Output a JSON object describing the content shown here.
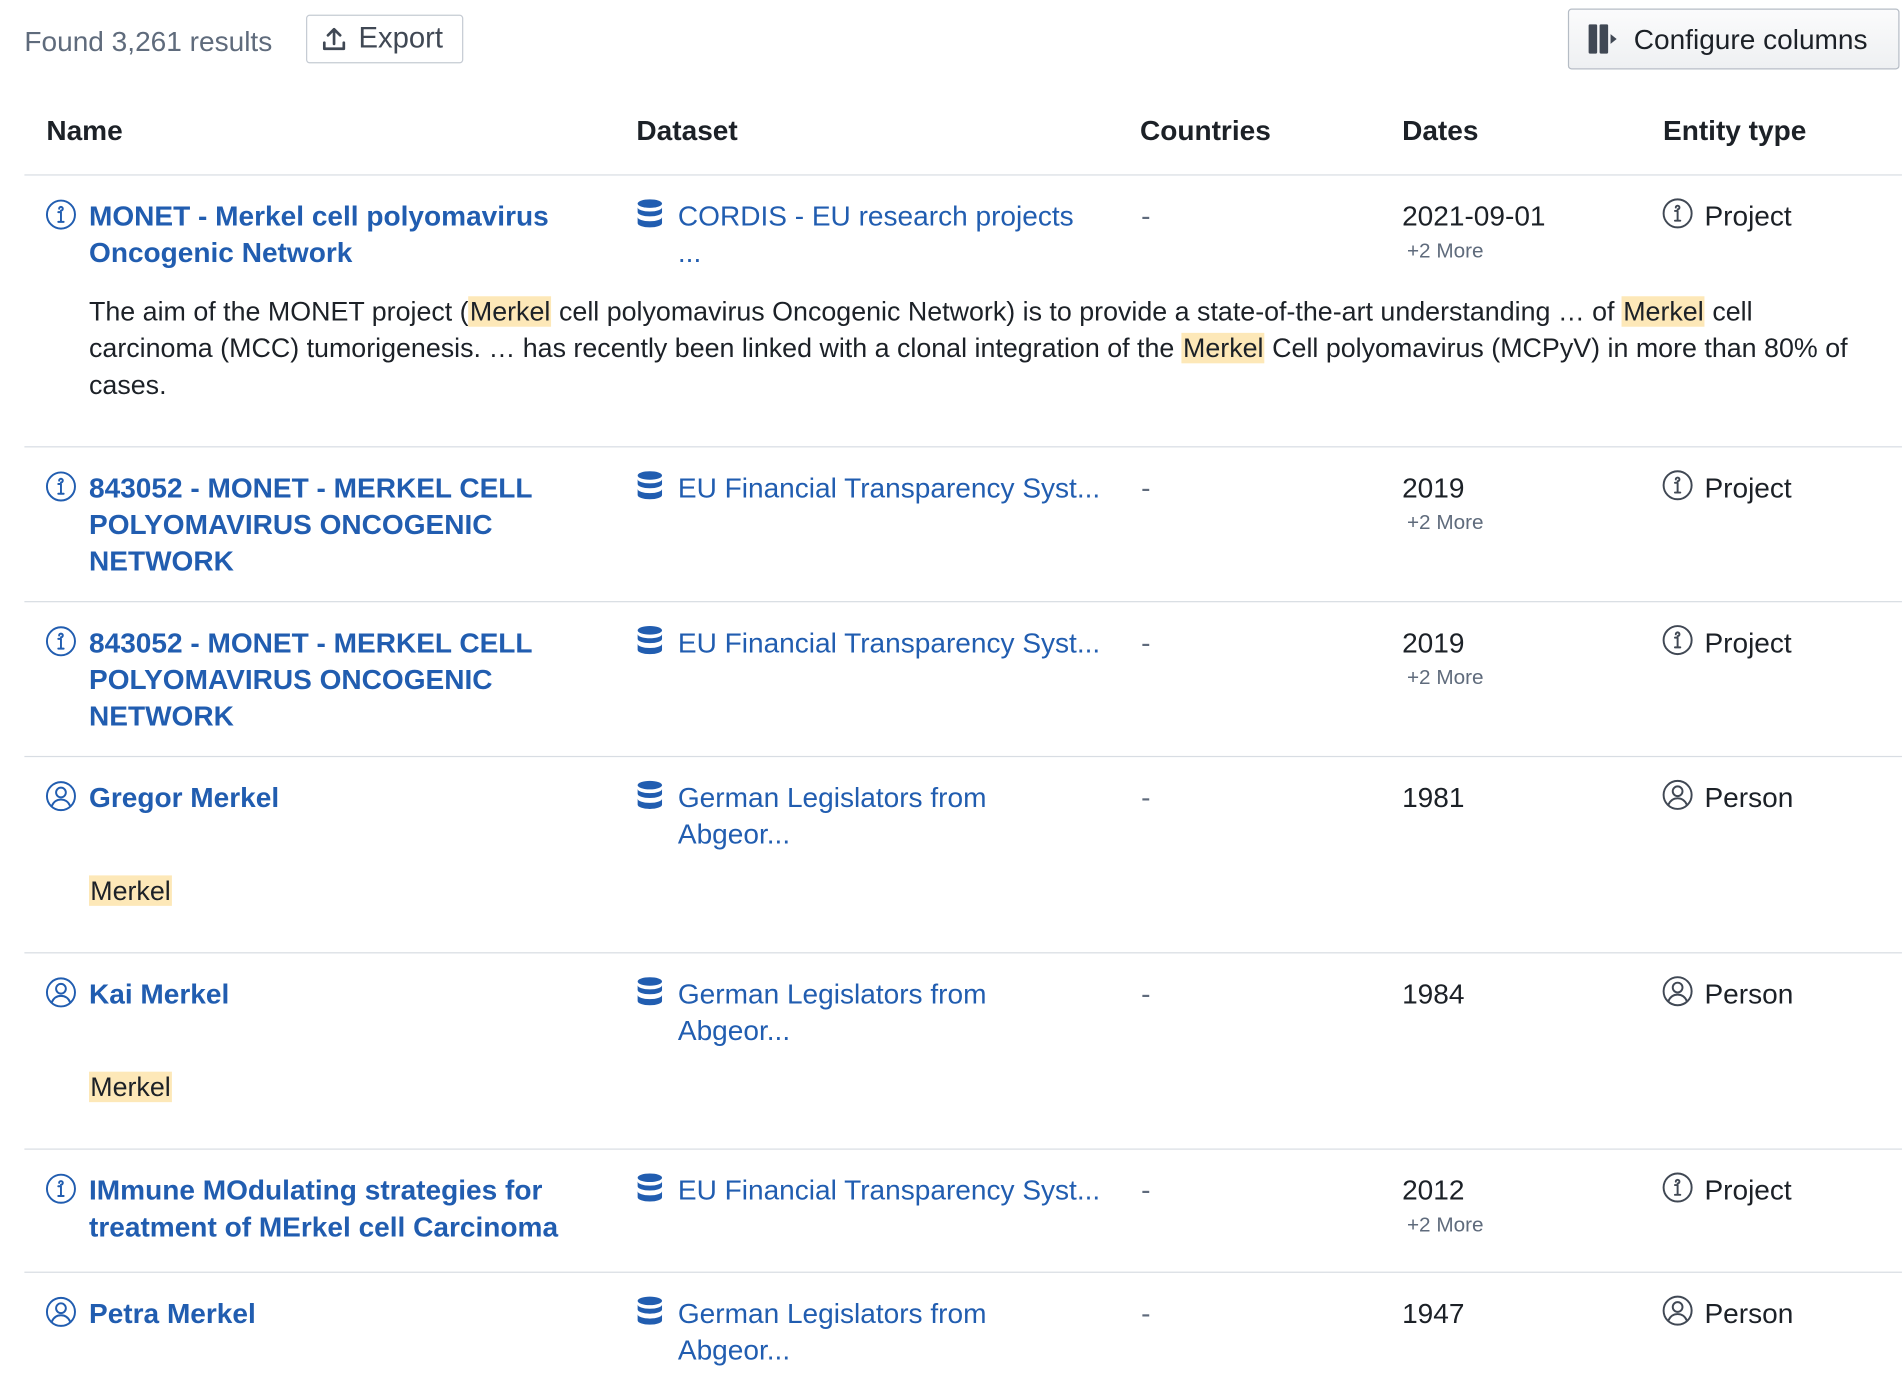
{
  "toolbar": {
    "found_text": "Found 3,261 results",
    "export_label": "Export",
    "configure_label": "Configure columns"
  },
  "columns": [
    "Name",
    "Dataset",
    "Countries",
    "Dates",
    "Entity type"
  ],
  "rows": [
    {
      "icon": "project-icon",
      "name": "MONET - Merkel cell polyomavirus Oncogenic Network",
      "dataset": "CORDIS - EU research projects ...",
      "countries": "-",
      "date": "2021-09-01",
      "more": "+2 More",
      "entity_type": "Project",
      "snippet": [
        {
          "text": "The aim of the MONET project ("
        },
        {
          "text": "Merkel",
          "hl": true
        },
        {
          "text": " cell polyomavirus Oncogenic Network) is to provide a state-of-the-art understanding … of "
        },
        {
          "text": "Merkel",
          "hl": true
        },
        {
          "text": " cell carcinoma (MCC) tumorigenesis. … has recently been linked with a clonal integration of the "
        },
        {
          "text": "Merkel",
          "hl": true
        },
        {
          "text": " Cell polyomavirus (MCPyV) in more than 80% of cases."
        }
      ]
    },
    {
      "icon": "project-icon",
      "name": "843052 - MONET - MERKEL CELL POLYOMAVIRUS ONCOGENIC NETWORK",
      "dataset": "EU Financial Transparency Syst...",
      "countries": "-",
      "date": "2019",
      "more": "+2 More",
      "entity_type": "Project",
      "snippet": []
    },
    {
      "icon": "project-icon",
      "name": "843052 - MONET - MERKEL CELL POLYOMAVIRUS ONCOGENIC NETWORK",
      "dataset": "EU Financial Transparency Syst...",
      "countries": "-",
      "date": "2019",
      "more": "+2 More",
      "entity_type": "Project",
      "snippet": []
    },
    {
      "icon": "person-icon",
      "name": "Gregor Merkel",
      "dataset": "German Legislators from Abgeor...",
      "countries": "-",
      "date": "1981",
      "more": "",
      "entity_type": "Person",
      "snippet": [
        {
          "text": "Merkel",
          "hl": true
        }
      ]
    },
    {
      "icon": "person-icon",
      "name": "Kai Merkel",
      "dataset": "German Legislators from Abgeor...",
      "countries": "-",
      "date": "1984",
      "more": "",
      "entity_type": "Person",
      "snippet": [
        {
          "text": "Merkel",
          "hl": true
        }
      ]
    },
    {
      "icon": "project-icon",
      "name": "IMmune MOdulating strategies for treatment of MErkel cell Carcinoma",
      "dataset": "EU Financial Transparency Syst...",
      "countries": "-",
      "date": "2012",
      "more": "+2 More",
      "entity_type": "Project",
      "snippet": []
    },
    {
      "icon": "person-icon",
      "name": "Petra Merkel",
      "dataset": "German Legislators from Abgeor...",
      "countries": "-",
      "date": "1947",
      "more": "",
      "entity_type": "Person",
      "snippet": []
    }
  ],
  "colors": {
    "link": "#215db0",
    "highlight": "#fde8b8",
    "muted": "#5f6b7c",
    "divider": "#d8dde3"
  }
}
